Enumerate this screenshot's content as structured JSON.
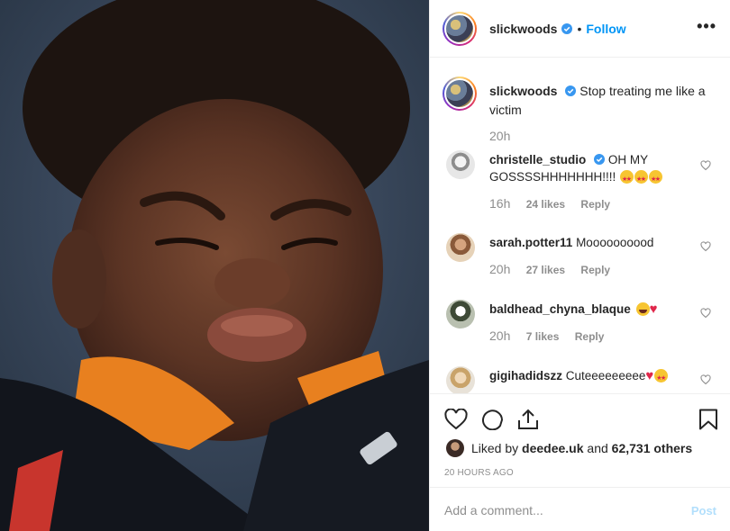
{
  "post": {
    "photo_alt": "",
    "owner": "slickwoods",
    "follow_label": "Follow",
    "more_label": "•••",
    "dot": "•"
  },
  "caption": {
    "username": "slickwoods",
    "text": "Stop treating me like a victim",
    "time": "20h"
  },
  "comments": [
    {
      "username": "christelle_studio",
      "verified": true,
      "text": "OH MY GOSSSSHHHHHHH!!!!",
      "emoji": [
        "heart-eyes",
        "heart-eyes",
        "heart-eyes"
      ],
      "time": "16h",
      "likes": "24 likes",
      "reply": "Reply"
    },
    {
      "username": "sarah.potter11",
      "verified": false,
      "text": "Moooooooood",
      "emoji": [],
      "time": "20h",
      "likes": "27 likes",
      "reply": "Reply"
    },
    {
      "username": "baldhead_chyna_blaque",
      "verified": false,
      "text": "",
      "emoji": [
        "laughing",
        "red-heart"
      ],
      "time": "20h",
      "likes": "7 likes",
      "reply": "Reply"
    },
    {
      "username": "gigihadidszz",
      "verified": false,
      "text": "Cuteeeeeeeee",
      "emoji": [
        "red-heart",
        "heart-eyes"
      ],
      "time": "",
      "likes": "",
      "reply": ""
    }
  ],
  "likes": {
    "prefix": "Liked by",
    "user": "deedee.uk",
    "joiner": "and",
    "others": "62,731 others"
  },
  "timestamp": "20 HOURS AGO",
  "add_comment": {
    "placeholder": "Add a comment...",
    "post_label": "Post"
  },
  "icons": {
    "like": "heart-outline-icon",
    "comment": "comment-bubble-icon",
    "share": "share-icon",
    "save": "bookmark-icon",
    "verified": "verified-badge-icon"
  },
  "colors": {
    "accent": "#0095f6",
    "verified": "#3897f0",
    "muted": "#8e8e8e",
    "post_disabled": "#b2dffc"
  }
}
